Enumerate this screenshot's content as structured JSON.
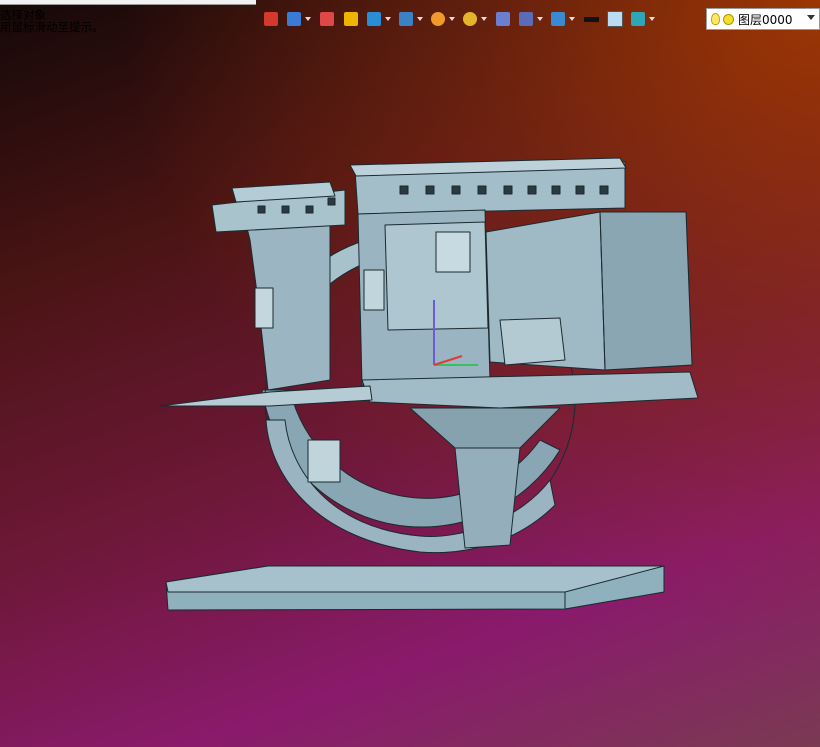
{
  "hint": {
    "line1": "选择对象",
    "line2": "用鼠标滑动至提示。"
  },
  "toolbar": {
    "items": [
      {
        "icon": "exit-icon",
        "dropdown": false,
        "color": "#d33a2c"
      },
      {
        "icon": "view-orient-icon",
        "dropdown": true,
        "color": "#3a7bd5"
      },
      {
        "icon": "pencil-icon",
        "dropdown": false,
        "color": "#e04848"
      },
      {
        "icon": "solid-box-icon",
        "dropdown": false,
        "color": "#f0b400"
      },
      {
        "icon": "cube-icon",
        "dropdown": true,
        "color": "#2a8ed6"
      },
      {
        "icon": "section-cube-icon",
        "dropdown": true,
        "color": "#3b82c4"
      },
      {
        "icon": "render-sphere-icon",
        "dropdown": true,
        "color": "#f09a2c"
      },
      {
        "icon": "zoom-icon",
        "dropdown": true,
        "color": "#e3b52a"
      },
      {
        "icon": "rotate-view-icon",
        "dropdown": false,
        "color": "#6a7fd0"
      },
      {
        "icon": "dimension-icon",
        "dropdown": true,
        "color": "#5b6bb8"
      },
      {
        "icon": "display-monitor-icon",
        "dropdown": true,
        "color": "#3a8ad2"
      },
      {
        "icon": "line-color-icon",
        "dropdown": false,
        "color": "#111111"
      },
      {
        "icon": "fill-color-icon",
        "dropdown": false,
        "color": "#b9dcf2"
      },
      {
        "icon": "layer-stack-icon",
        "dropdown": true,
        "color": "#2fa6b8"
      }
    ]
  },
  "layer_select": {
    "value": "图层0000"
  },
  "colors": {
    "model_fill": "#93aebb",
    "model_stroke": "#1a2a30"
  }
}
